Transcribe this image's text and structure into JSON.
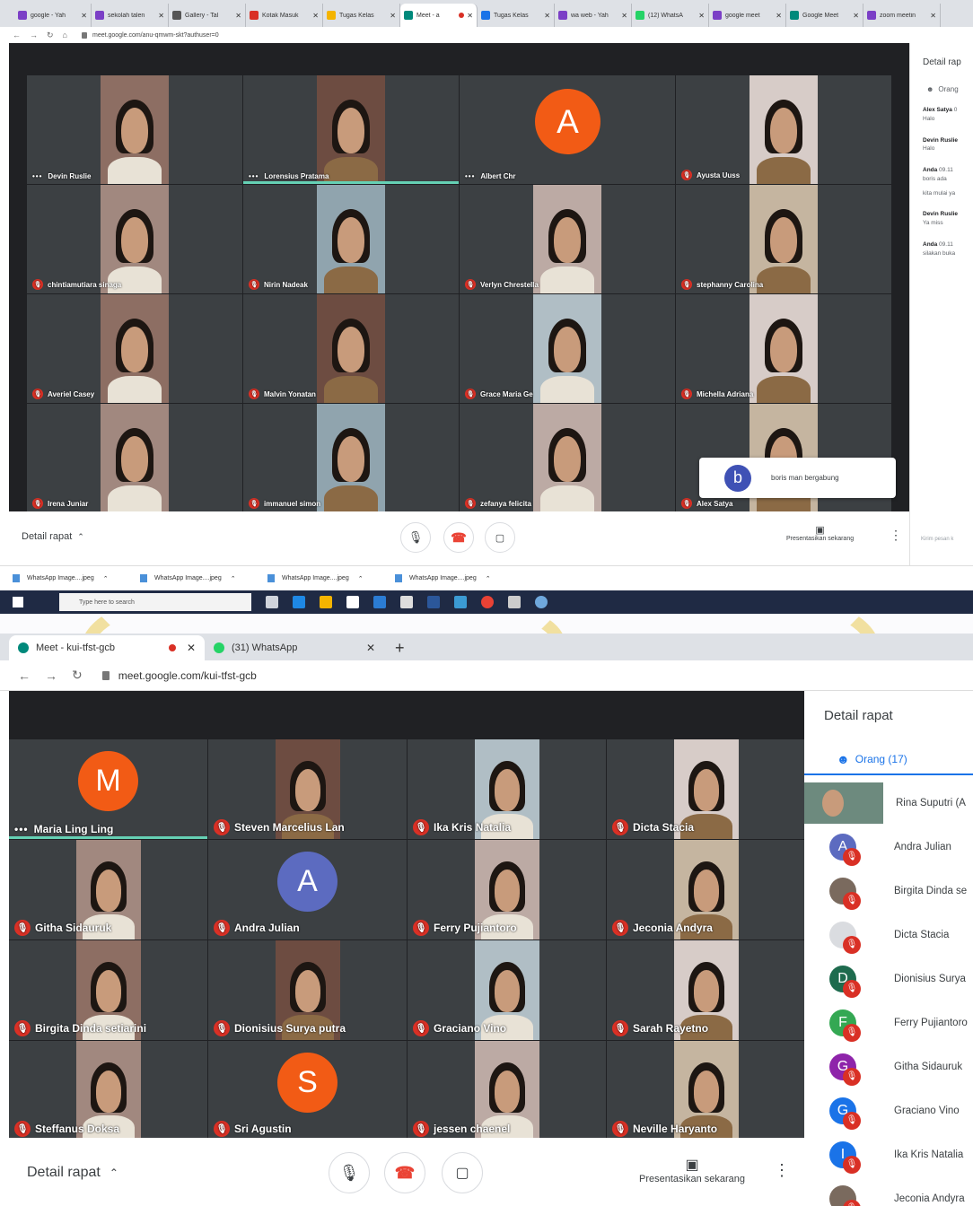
{
  "shot1": {
    "tabs": [
      {
        "label": "google - Yah",
        "color": "#7b3fc6"
      },
      {
        "label": "sekolah talen",
        "color": "#7b3fc6"
      },
      {
        "label": "Gallery - Tal",
        "color": "#555555"
      },
      {
        "label": "Kotak Masuk",
        "color": "#d93025"
      },
      {
        "label": "Tugas Kelas",
        "color": "#f4b400"
      },
      {
        "label": "Meet - a",
        "color": "#00897b",
        "active": true
      },
      {
        "label": "Tugas Kelas",
        "color": "#1a73e8"
      },
      {
        "label": "wa web - Yah",
        "color": "#7b3fc6"
      },
      {
        "label": "(12) WhatsA",
        "color": "#25d366"
      },
      {
        "label": "google meet",
        "color": "#7b3fc6"
      },
      {
        "label": "Google Meet",
        "color": "#00897b"
      },
      {
        "label": "zoom meetin",
        "color": "#7b3fc6"
      }
    ],
    "url": "meet.google.com/anu-qmwm-skt?authuser=0",
    "participants": [
      {
        "name": "Devin Ruslie",
        "icon": "dots"
      },
      {
        "name": "Lorensius Pratama",
        "icon": "dots",
        "speaking": true
      },
      {
        "name": "Albert Chr",
        "icon": "dots",
        "avatar": "A",
        "avatar_color": "#f25b15"
      },
      {
        "name": "Ayusta Uuss",
        "icon": "mic-off"
      },
      {
        "name": "chintiamutiara sinaga",
        "icon": "mic-off"
      },
      {
        "name": "Nirin Nadeak",
        "icon": "mic-off"
      },
      {
        "name": "Verlyn Chrestella",
        "icon": "mic-off"
      },
      {
        "name": "stephanny Carolina",
        "icon": "mic-off"
      },
      {
        "name": "Averiel Casey",
        "icon": "mic-off"
      },
      {
        "name": "Malvin Yonatan",
        "icon": "mic-off"
      },
      {
        "name": "Grace Maria Ge",
        "icon": "mic-off"
      },
      {
        "name": "Michella Adriana",
        "icon": "mic-off"
      },
      {
        "name": "Irena Juniar",
        "icon": "mic-off"
      },
      {
        "name": "immanuel simon",
        "icon": "mic-off"
      },
      {
        "name": "zefanya felicita",
        "icon": "mic-off"
      },
      {
        "name": "Alex Satya",
        "icon": "mic-off"
      }
    ],
    "toast": {
      "avatar": "b",
      "text": "boris man bergabung"
    },
    "panel": {
      "title": "Detail rap",
      "people_tab": "Orang",
      "messages": [
        {
          "sender": "Alex Satya",
          "time": "0",
          "text": "Halo"
        },
        {
          "sender": "Devin Ruslie",
          "time": "",
          "text": "Halo"
        },
        {
          "sender": "Anda",
          "time": "09.11",
          "text": "boris ada",
          "extra": "kita mulai ya"
        },
        {
          "sender": "Devin Ruslie",
          "time": "",
          "text": "Ya miss"
        },
        {
          "sender": "Anda",
          "time": "09.11",
          "text": "silakan buka"
        }
      ],
      "input_placeholder": "Kirim pesan k"
    },
    "bottom": {
      "details": "Detail rapat",
      "present": "Presentasikan sekarang"
    },
    "downloads": [
      "WhatsApp Image....jpeg",
      "WhatsApp Image....jpeg",
      "WhatsApp Image....jpeg",
      "WhatsApp Image....jpeg"
    ],
    "taskbar_search": "Type here to search"
  },
  "shot2": {
    "tabs": [
      {
        "label": "Meet - kui-tfst-gcb",
        "color": "#00897b",
        "active": true
      },
      {
        "label": "(31) WhatsApp",
        "color": "#25d366"
      }
    ],
    "new_tab": "+",
    "url": "meet.google.com/kui-tfst-gcb",
    "participants": [
      {
        "name": "Maria Ling Ling",
        "icon": "dots",
        "avatar": "M",
        "avatar_color": "#f25b15",
        "speaking": true
      },
      {
        "name": "Steven Marcelius Lan",
        "icon": "mic-off"
      },
      {
        "name": "Ika Kris Natalia",
        "icon": "mic-off"
      },
      {
        "name": "Dicta Stacia",
        "icon": "mic-off"
      },
      {
        "name": "Githa Sidauruk",
        "icon": "mic-off"
      },
      {
        "name": "Andra Julian",
        "icon": "mic-off",
        "avatar": "A",
        "avatar_color": "#5c6bc0"
      },
      {
        "name": "Ferry Pujiantoro",
        "icon": "mic-off"
      },
      {
        "name": "Jeconia Andyra",
        "icon": "mic-off"
      },
      {
        "name": "Birgita Dinda setiarini",
        "icon": "mic-off"
      },
      {
        "name": "Dionisius Surya putra",
        "icon": "mic-off"
      },
      {
        "name": "Graciano Vino",
        "icon": "mic-off"
      },
      {
        "name": "Sarah Rayetno",
        "icon": "mic-off"
      },
      {
        "name": "Steffanus Doksa",
        "icon": "mic-off"
      },
      {
        "name": "Sri Agustin",
        "icon": "mic-off",
        "avatar": "S",
        "avatar_color": "#f25b15"
      },
      {
        "name": "jessen chaenel",
        "icon": "mic-off"
      },
      {
        "name": "Neville Haryanto",
        "icon": "mic-off"
      }
    ],
    "panel": {
      "title": "Detail rapat",
      "people_tab": "Orang (17)",
      "people": [
        {
          "name": "Rina Suputri (A",
          "type": "video"
        },
        {
          "name": "Andra Julian",
          "initial": "A",
          "color": "#5c6bc0"
        },
        {
          "name": "Birgita Dinda se",
          "type": "photo"
        },
        {
          "name": "Dicta Stacia",
          "initial": "",
          "color": "#dadce0"
        },
        {
          "name": "Dionisius Surya",
          "initial": "D",
          "color": "#1e6b4e"
        },
        {
          "name": "Ferry Pujiantoro",
          "initial": "F",
          "color": "#34a853"
        },
        {
          "name": "Githa Sidauruk",
          "initial": "G",
          "color": "#8e24aa"
        },
        {
          "name": "Graciano Vino",
          "initial": "G",
          "color": "#1a73e8"
        },
        {
          "name": "Ika Kris Natalia",
          "initial": "I",
          "color": "#1a73e8"
        },
        {
          "name": "Jeconia Andyra",
          "type": "photo"
        }
      ]
    },
    "bottom": {
      "details": "Detail rapat",
      "present": "Presentasikan sekarang"
    }
  },
  "colors": {
    "stage": "#202124",
    "tile": "#3c4043",
    "mic_off": "#d93025",
    "speaking": "#65d0b4",
    "accent": "#1a73e8"
  }
}
